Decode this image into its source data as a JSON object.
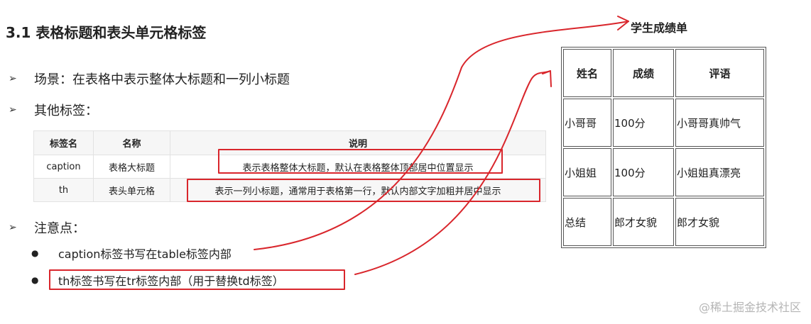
{
  "heading": "3.1 表格标题和表头单元格标签",
  "bullets": {
    "scene": "场景：在表格中表示整体大标题和一列小标题",
    "other_tags": "其他标签：",
    "notes": "注意点："
  },
  "tag_table": {
    "headers": [
      "标签名",
      "名称",
      "说明"
    ],
    "rows": [
      [
        "caption",
        "表格大标题",
        "表示表格整体大标题，默认在表格整体顶部居中位置显示"
      ],
      [
        "th",
        "表头单元格",
        "表示一列小标题，通常用于表格第一行，默认内部文字加粗并居中显示"
      ]
    ]
  },
  "notes": [
    "caption标签书写在table标签内部",
    "th标签书写在tr标签内部（用于替换td标签）"
  ],
  "score_table": {
    "caption": "学生成绩单",
    "headers": [
      "姓名",
      "成绩",
      "评语"
    ],
    "rows": [
      [
        "小哥哥",
        "100分",
        "小哥哥真帅气"
      ],
      [
        "小姐姐",
        "100分",
        "小姐姐真漂亮"
      ],
      [
        "总结",
        "郎才女貌",
        "郎才女貌"
      ]
    ]
  },
  "watermark": "@稀土掘金技术社区",
  "annotation_color": "#d9262c",
  "annotation_marks": [
    {
      "kind": "highlight-box",
      "target": "tag_table.rows.0.2"
    },
    {
      "kind": "highlight-box",
      "target": "tag_table.rows.1.2"
    },
    {
      "kind": "highlight-box",
      "target": "notes.1"
    },
    {
      "kind": "connector-arrow",
      "from": "notes.0",
      "to": "score_table.caption"
    },
    {
      "kind": "connector-arrow",
      "from": "notes.1",
      "to": "score_table.headers"
    }
  ]
}
